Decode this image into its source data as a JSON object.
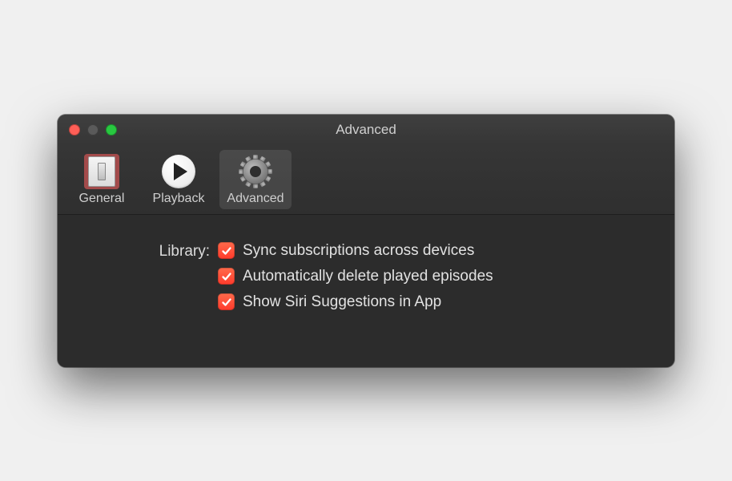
{
  "window": {
    "title": "Advanced"
  },
  "tabs": {
    "general": {
      "label": "General"
    },
    "playback": {
      "label": "Playback"
    },
    "advanced": {
      "label": "Advanced"
    }
  },
  "section": {
    "label": "Library:",
    "options": {
      "sync": {
        "label": "Sync subscriptions across devices",
        "checked": true
      },
      "delete": {
        "label": "Automatically delete played episodes",
        "checked": true
      },
      "siri": {
        "label": "Show Siri Suggestions in App",
        "checked": true
      }
    }
  }
}
